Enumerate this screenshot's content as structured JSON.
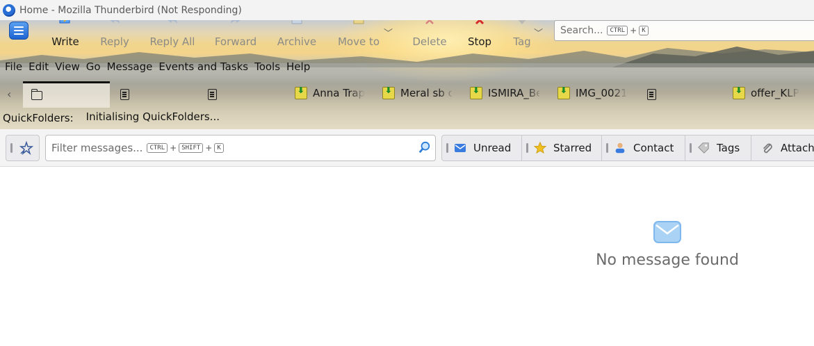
{
  "window": {
    "title": "Home - Mozilla Thunderbird (Not Responding)"
  },
  "toolbar": {
    "write": "Write",
    "reply": "Reply",
    "reply_all": "Reply All",
    "forward": "Forward",
    "archive": "Archive",
    "move_to": "Move to",
    "delete": "Delete",
    "stop": "Stop",
    "tag": "Tag"
  },
  "search": {
    "placeholder": "Search...",
    "key1": "CTRL",
    "plus": "+",
    "key2": "K"
  },
  "menu": [
    "File",
    "Edit",
    "View",
    "Go",
    "Message",
    "Events and Tasks",
    "Tools",
    "Help"
  ],
  "quicktabs": [
    "Anna Trap",
    "Meral sb c",
    "ISMIRA_Be",
    "IMG_0021",
    "offer_KLP"
  ],
  "quickfolders": {
    "label": "QuickFolders:",
    "status": "Initialising QuickFolders..."
  },
  "filter": {
    "placeholder": "Filter messages...",
    "key1": "CTRL",
    "key2": "SHIFT",
    "key3": "K",
    "plus": "+",
    "unread": "Unread",
    "starred": "Starred",
    "contact": "Contact",
    "tags": "Tags",
    "attachment": "Attach"
  },
  "empty_state": {
    "message": "No message found"
  },
  "colors": {
    "accent": "#1c63d2",
    "stop": "#d42a2a",
    "star": "#f0c020",
    "envelope": "#7db7ec"
  }
}
